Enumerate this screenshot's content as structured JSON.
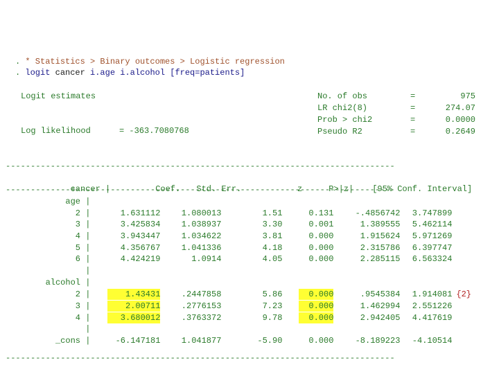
{
  "commands": [
    {
      "prompt": ". ",
      "comment": "* Statistics > Binary outcomes > Logistic regression"
    },
    {
      "prompt": ". ",
      "keyword": "logit",
      "args_plain": " cancer ",
      "args_blue": "i.age i.alcohol [freq=patients]"
    }
  ],
  "header": {
    "model_title": "Logit estimates",
    "loglik_label": "Log likelihood",
    "loglik_value": "= -363.7080768",
    "stats": [
      {
        "label": "No. of obs",
        "eq": "=",
        "value": "975"
      },
      {
        "label": "LR chi2(8)",
        "eq": "=",
        "value": "274.07"
      },
      {
        "label": "Prob > chi2",
        "eq": "=",
        "value": "0.0000"
      },
      {
        "label": "Pseudo R2",
        "eq": "=",
        "value": "0.2649"
      }
    ]
  },
  "table": {
    "rule_top": "------------------------------------------------------------------------------",
    "rule_mid": "-------------+----------------------------------------------------------------",
    "rule_bottom": "------------------------------------------------------------------------------",
    "depvar": "cancer",
    "columns": [
      "Coef.",
      "Std. Err.",
      "z",
      "P>|z|",
      "[95% Conf. Interval]"
    ],
    "rows": [
      {
        "label": "age",
        "cells": null
      },
      {
        "label": "2",
        "cells": [
          "1.631112",
          "1.080013",
          "1.51",
          "0.131",
          "-.4856742",
          "3.747899"
        ]
      },
      {
        "label": "3",
        "cells": [
          "3.425834",
          "1.038937",
          "3.30",
          "0.001",
          "1.389555",
          "5.462114"
        ]
      },
      {
        "label": "4",
        "cells": [
          "3.943447",
          "1.034622",
          "3.81",
          "0.000",
          "1.915624",
          "5.971269"
        ]
      },
      {
        "label": "5",
        "cells": [
          "4.356767",
          "1.041336",
          "4.18",
          "0.000",
          "2.315786",
          "6.397747"
        ]
      },
      {
        "label": "6",
        "cells": [
          "4.424219",
          "1.0914",
          "4.05",
          "0.000",
          "2.285115",
          "6.563324"
        ]
      },
      {
        "label": "",
        "cells": null
      },
      {
        "label": "alcohol",
        "cells": null
      },
      {
        "label": "2",
        "cells": [
          "1.43431",
          ".2447858",
          "5.86",
          "0.000",
          ".9545384",
          "1.914081"
        ],
        "note": "{2}"
      },
      {
        "label": "3",
        "cells": [
          "2.00711",
          ".2776153",
          "7.23",
          "0.000",
          "1.462994",
          "2.551226"
        ]
      },
      {
        "label": "4",
        "cells": [
          "3.680012",
          ".3763372",
          "9.78",
          "0.000",
          "2.942405",
          "4.417619"
        ]
      },
      {
        "label": "",
        "cells": null
      },
      {
        "label": "_cons",
        "cells": [
          "-6.147181",
          "1.041877",
          "-5.90",
          "0.000",
          "-8.189223",
          "-4.10514"
        ]
      }
    ],
    "highlight_color": "#ffff33"
  }
}
